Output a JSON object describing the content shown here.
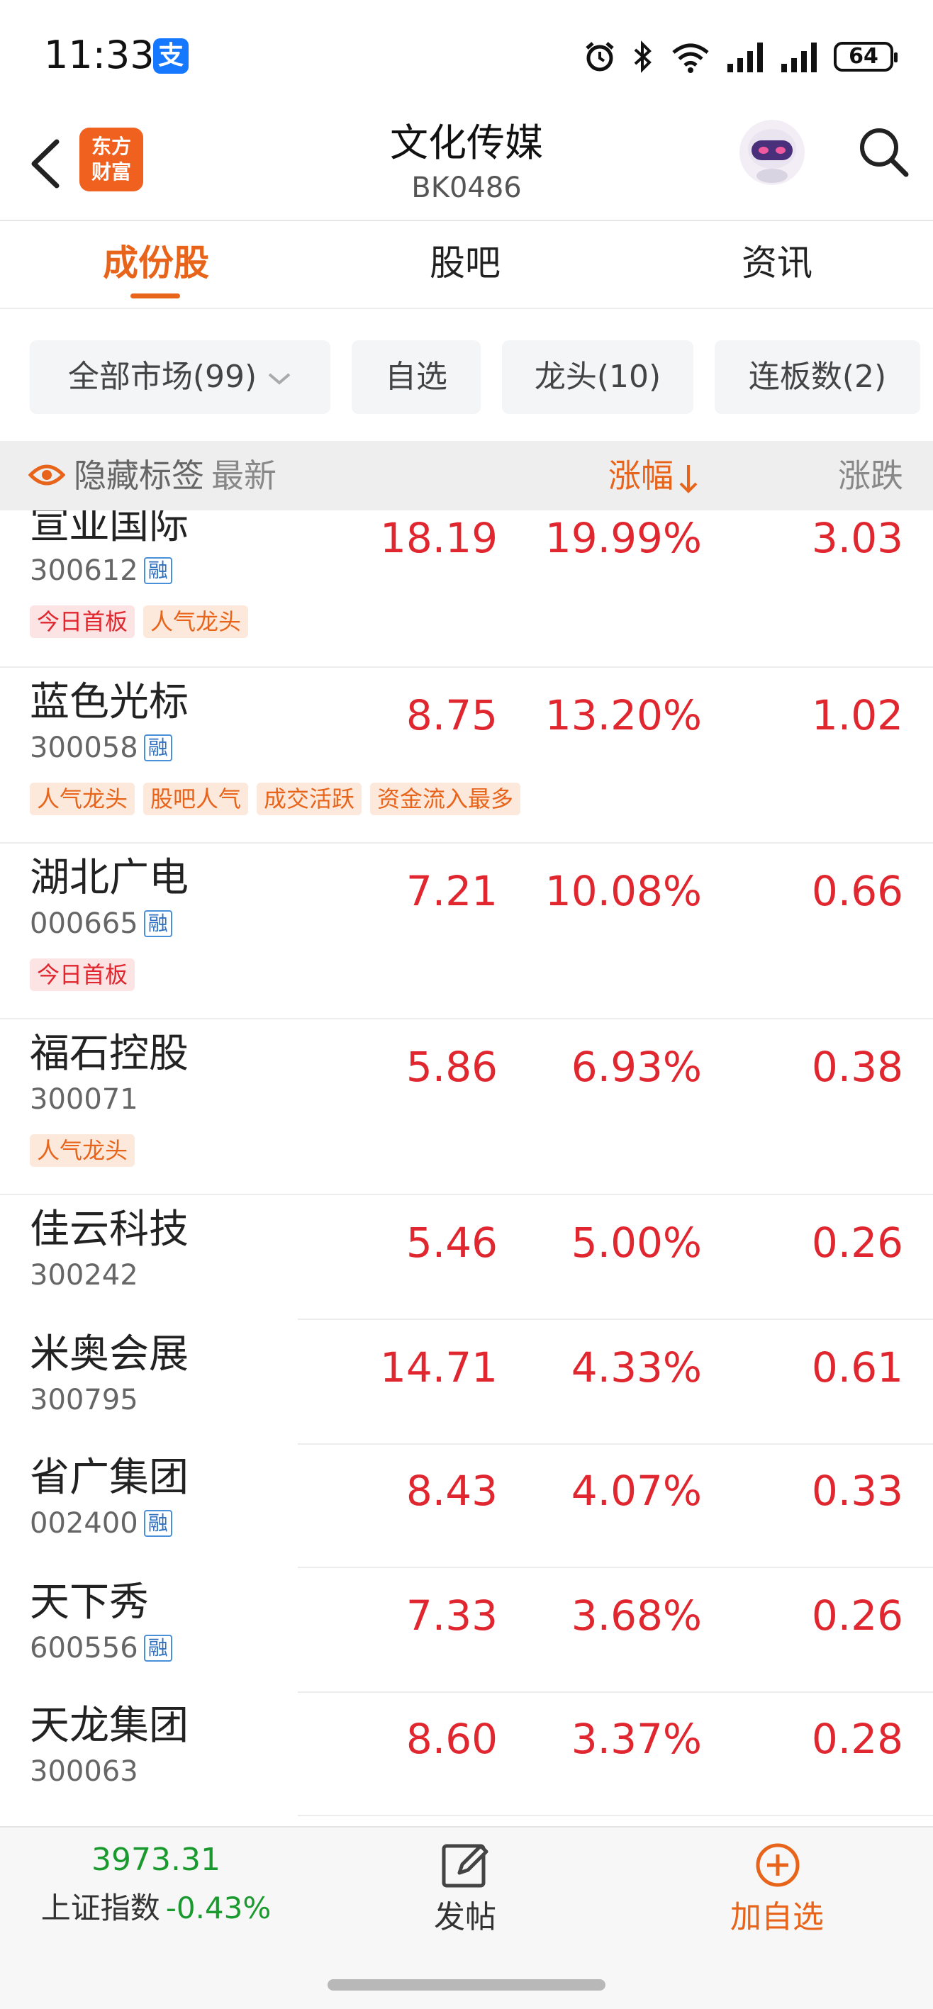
{
  "status_bar": {
    "time": "11:33",
    "app_badge": "支",
    "battery": "64"
  },
  "header": {
    "logo_line1": "东方",
    "logo_line2": "财富",
    "title": "文化传媒",
    "subtitle": "BK0486"
  },
  "tabs": [
    {
      "label": "成份股",
      "active": true
    },
    {
      "label": "股吧",
      "active": false
    },
    {
      "label": "资讯",
      "active": false
    }
  ],
  "filters": [
    {
      "label": "全部市场(99)"
    },
    {
      "label": "自选"
    },
    {
      "label": "龙头(10)"
    },
    {
      "label": "连板数(2)"
    }
  ],
  "columns": {
    "hide_tags": "隐藏标签",
    "latest": "最新",
    "pct": "涨幅",
    "change": "涨跌"
  },
  "stocks": [
    {
      "name": "宣亚国际",
      "code": "300612",
      "rong": "融",
      "latest": "18.19",
      "pct": "19.99%",
      "change": "3.03",
      "tags": [
        {
          "text": "今日首板",
          "color": "red"
        },
        {
          "text": "人气龙头",
          "color": "orange"
        }
      ]
    },
    {
      "name": "蓝色光标",
      "code": "300058",
      "rong": "融",
      "latest": "8.75",
      "pct": "13.20%",
      "change": "1.02",
      "tags": [
        {
          "text": "人气龙头",
          "color": "orange"
        },
        {
          "text": "股吧人气",
          "color": "orange"
        },
        {
          "text": "成交活跃",
          "color": "orange"
        },
        {
          "text": "资金流入最多",
          "color": "orange"
        }
      ]
    },
    {
      "name": "湖北广电",
      "code": "000665",
      "rong": "融",
      "latest": "7.21",
      "pct": "10.08%",
      "change": "0.66",
      "tags": [
        {
          "text": "今日首板",
          "color": "red"
        }
      ]
    },
    {
      "name": "福石控股",
      "code": "300071",
      "rong": "",
      "latest": "5.86",
      "pct": "6.93%",
      "change": "0.38",
      "tags": [
        {
          "text": "人气龙头",
          "color": "orange"
        }
      ]
    },
    {
      "name": "佳云科技",
      "code": "300242",
      "rong": "",
      "latest": "5.46",
      "pct": "5.00%",
      "change": "0.26",
      "tags": []
    },
    {
      "name": "米奥会展",
      "code": "300795",
      "rong": "",
      "latest": "14.71",
      "pct": "4.33%",
      "change": "0.61",
      "tags": []
    },
    {
      "name": "省广集团",
      "code": "002400",
      "rong": "融",
      "latest": "8.43",
      "pct": "4.07%",
      "change": "0.33",
      "tags": []
    },
    {
      "name": "天下秀",
      "code": "600556",
      "rong": "融",
      "latest": "7.33",
      "pct": "3.68%",
      "change": "0.26",
      "tags": []
    },
    {
      "name": "天龙集团",
      "code": "300063",
      "rong": "",
      "latest": "8.60",
      "pct": "3.37%",
      "change": "0.28",
      "tags": []
    }
  ],
  "bottom_bar": {
    "index_value": "3973.31",
    "index_name": "上证指数",
    "index_pct": "-0.43%",
    "post_label": "发帖",
    "add_label": "加自选"
  },
  "colors": {
    "accent": "#e8641b",
    "up": "#e0262e",
    "down": "#1a9a2e"
  }
}
